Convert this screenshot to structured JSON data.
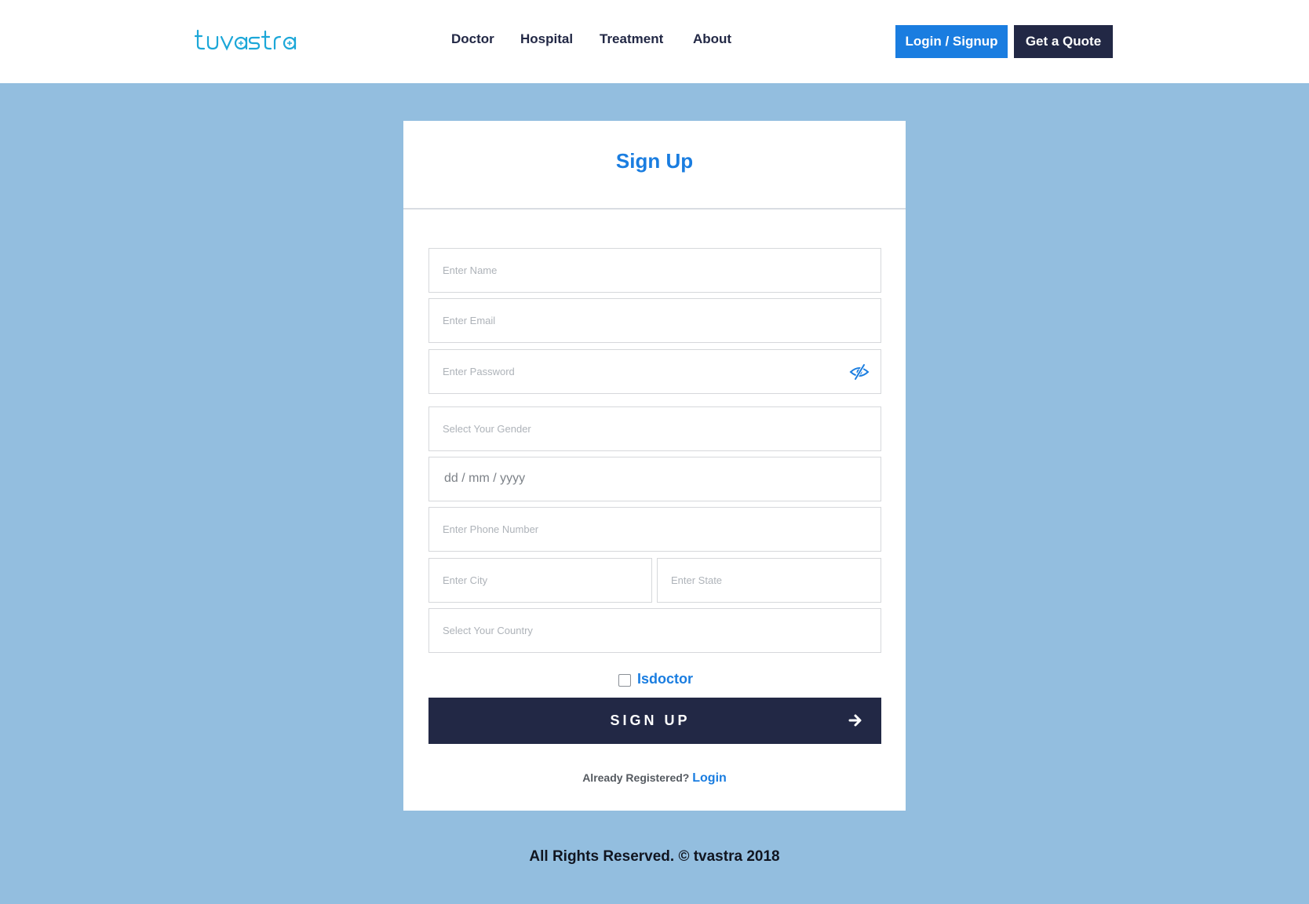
{
  "header": {
    "logo_text": "tvastra",
    "nav": [
      "Doctor",
      "Hospital",
      "Treatment",
      "About"
    ],
    "login_signup_label": "Login / Signup",
    "get_quote_label": "Get a Quote"
  },
  "form": {
    "title": "Sign Up",
    "placeholders": {
      "name": "Enter Name",
      "email": "Enter Email",
      "password": "Enter Password",
      "gender": "Select Your Gender",
      "dob": "dd / mm / yyyy",
      "phone": "Enter Phone Number",
      "city": "Enter City",
      "state": "Enter State",
      "country": "Select Your Country"
    },
    "isdoctor_label": "Isdoctor",
    "isdoctor_checked": false,
    "submit_label": "SIGN UP",
    "already_registered_text": "Already Registered?",
    "login_link": "Login"
  },
  "footer": {
    "copyright": "All Rights Reserved. © tvastra 2018"
  },
  "colors": {
    "background": "#93bedf",
    "accent": "#1a7de0",
    "dark": "#222845"
  },
  "icons": {
    "password_toggle": "eye-slash-icon",
    "submit_arrow": "arrow-right-icon"
  }
}
